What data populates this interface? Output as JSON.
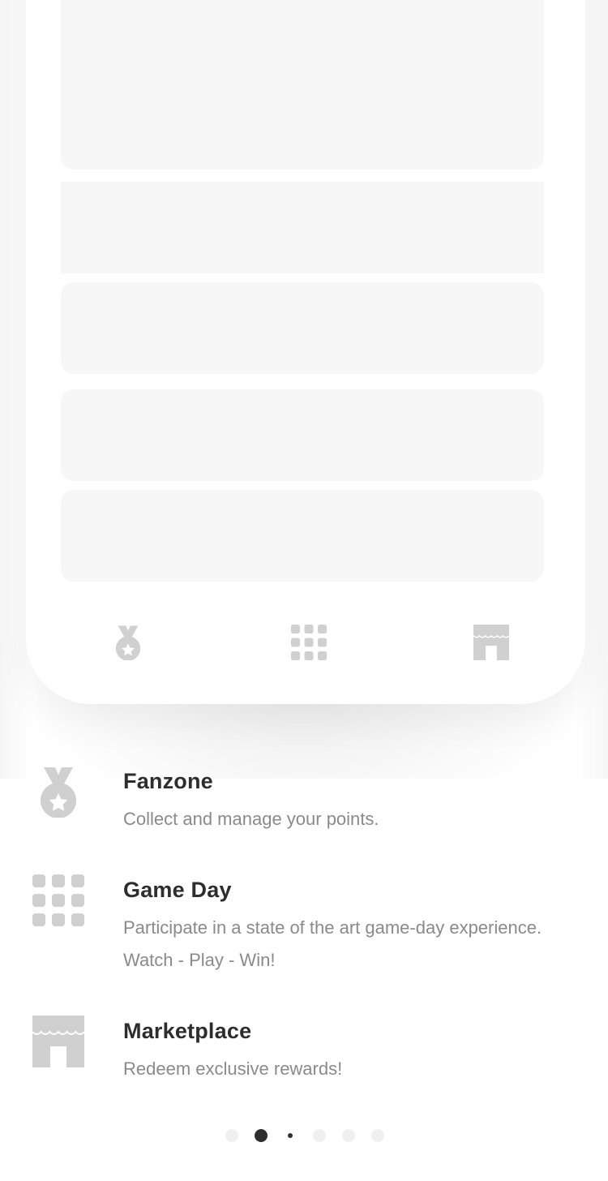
{
  "features": [
    {
      "icon": "medal-icon",
      "title": "Fanzone",
      "description": "Collect and manage your points."
    },
    {
      "icon": "grid-icon",
      "title": "Game Day",
      "description": "Participate in a state of the art game-day experience. Watch - Play - Win!"
    },
    {
      "icon": "storefront-icon",
      "title": "Marketplace",
      "description": "Redeem exclusive rewards!"
    }
  ],
  "tabbar": {
    "items": [
      "medal-icon",
      "grid-icon",
      "storefront-icon"
    ]
  },
  "pagination": {
    "total": 6,
    "active_index": 1
  },
  "colors": {
    "icon_grey": "#d0d0d0",
    "placeholder_grey": "#f7f7f7",
    "title_text": "#2d2d2d",
    "body_text": "#8a8a8a",
    "dot_active": "#2f2f2f",
    "dot_inactive": "#f0f0f0"
  }
}
